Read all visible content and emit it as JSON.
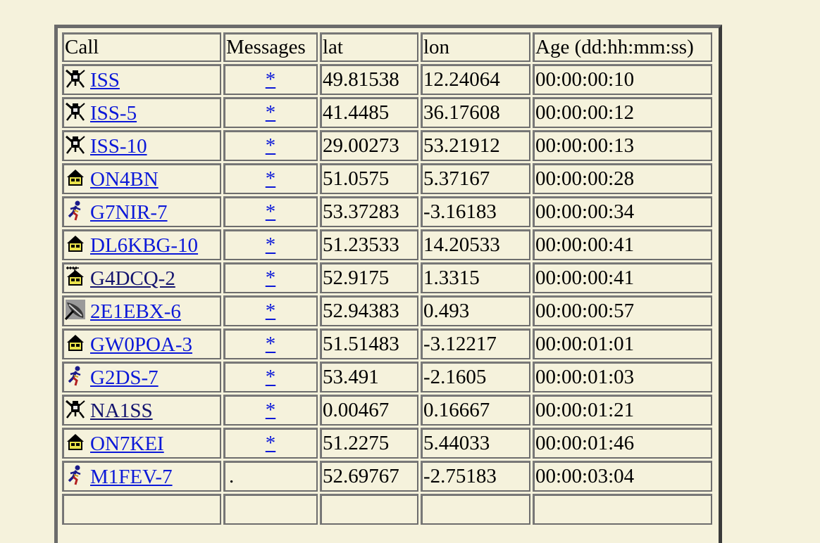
{
  "table": {
    "headers": [
      "Call",
      "Messages",
      "lat",
      "lon",
      "Age (dd:hh:mm:ss)"
    ],
    "rows": [
      {
        "icon": "satellite-icon",
        "call": "ISS",
        "messages": "*",
        "lat": "49.81538",
        "lon": "12.24064",
        "age": "00:00:00:10",
        "visited": false
      },
      {
        "icon": "satellite-icon",
        "call": "ISS-5",
        "messages": "*",
        "lat": "41.4485",
        "lon": "36.17608",
        "age": "00:00:00:12",
        "visited": false
      },
      {
        "icon": "satellite-icon",
        "call": "ISS-10",
        "messages": "*",
        "lat": "29.00273",
        "lon": "53.21912",
        "age": "00:00:00:13",
        "visited": false
      },
      {
        "icon": "house-icon",
        "call": "ON4BN",
        "messages": "*",
        "lat": "51.0575",
        "lon": "5.37167",
        "age": "00:00:00:28",
        "visited": false
      },
      {
        "icon": "runner-icon",
        "call": "G7NIR-7",
        "messages": "*",
        "lat": "53.37283",
        "lon": "-3.16183",
        "age": "00:00:00:34",
        "visited": false
      },
      {
        "icon": "house-icon",
        "call": "DL6KBG-10",
        "messages": "*",
        "lat": "51.23533",
        "lon": "14.20533",
        "age": "00:00:00:41",
        "visited": false
      },
      {
        "icon": "house-antenna-icon",
        "call": "G4DCQ-2",
        "messages": "*",
        "lat": "52.9175",
        "lon": "1.3315",
        "age": "00:00:00:41",
        "visited": true
      },
      {
        "icon": "dish-icon",
        "call": "2E1EBX-6",
        "messages": "*",
        "lat": "52.94383",
        "lon": "0.493",
        "age": "00:00:00:57",
        "visited": false
      },
      {
        "icon": "house-icon",
        "call": "GW0POA-3",
        "messages": "*",
        "lat": "51.51483",
        "lon": "-3.12217",
        "age": "00:00:01:01",
        "visited": false
      },
      {
        "icon": "runner-icon",
        "call": "G2DS-7",
        "messages": "*",
        "lat": "53.491",
        "lon": "-2.1605",
        "age": "00:00:01:03",
        "visited": false
      },
      {
        "icon": "satellite-icon",
        "call": "NA1SS",
        "messages": "*",
        "lat": "0.00467",
        "lon": "0.16667",
        "age": "00:00:01:21",
        "visited": true
      },
      {
        "icon": "house-icon",
        "call": "ON7KEI",
        "messages": "*",
        "lat": "51.2275",
        "lon": "5.44033",
        "age": "00:00:01:46",
        "visited": false
      },
      {
        "icon": "runner-icon",
        "call": "M1FEV-7",
        "messages": ".",
        "lat": "52.69767",
        "lon": "-2.75183",
        "age": "00:00:03:04",
        "visited": false
      }
    ]
  }
}
